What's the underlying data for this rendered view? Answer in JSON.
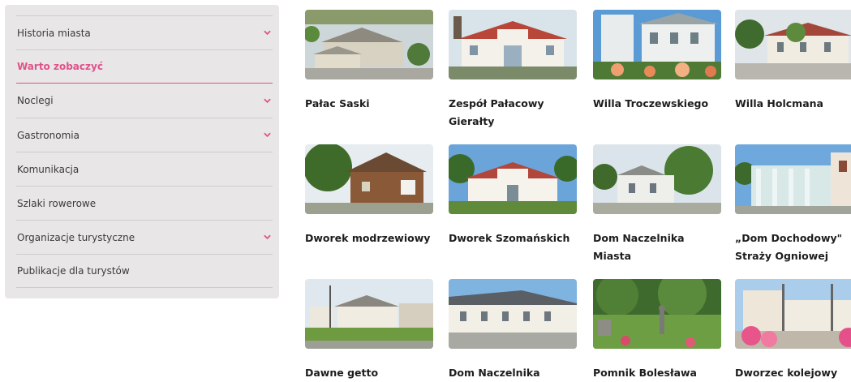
{
  "sidebar": {
    "items": [
      {
        "label": "Historia miasta",
        "has_chevron": true,
        "active": false
      },
      {
        "label": "Warto zobaczyć",
        "has_chevron": false,
        "active": true
      },
      {
        "label": "Noclegi",
        "has_chevron": true,
        "active": false
      },
      {
        "label": "Gastronomia",
        "has_chevron": true,
        "active": false
      },
      {
        "label": "Komunikacja",
        "has_chevron": false,
        "active": false
      },
      {
        "label": "Szlaki rowerowe",
        "has_chevron": false,
        "active": false
      },
      {
        "label": "Organizacje turystyczne",
        "has_chevron": true,
        "active": false
      },
      {
        "label": "Publikacje dla turystów",
        "has_chevron": false,
        "active": false
      }
    ]
  },
  "colors": {
    "accent": "#e0528a",
    "sidebar_bg": "#e8e6e6",
    "text": "#1d1d1d"
  },
  "attractions": [
    {
      "title": "Pałac Saski"
    },
    {
      "title": "Zespół Pałacowy Gierałty"
    },
    {
      "title": "Willa Troczewskiego"
    },
    {
      "title": "Willa Holcmana"
    },
    {
      "title": "Dworek modrzewiowy"
    },
    {
      "title": "Dworek Szomańskich"
    },
    {
      "title": "Dom Naczelnika Miasta"
    },
    {
      "title": "„Dom Dochodowy\" Straży Ogniowej"
    },
    {
      "title": "Dawne getto"
    },
    {
      "title": "Dom Naczelnika"
    },
    {
      "title": "Pomnik Bolesława"
    },
    {
      "title": "Dworzec kolejowy"
    }
  ]
}
